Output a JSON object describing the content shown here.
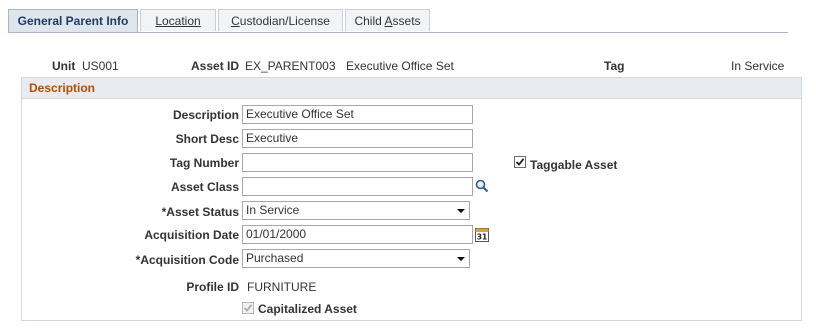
{
  "tabs": [
    {
      "label": "General Parent Info",
      "active": true
    },
    {
      "label": "Location"
    },
    {
      "pre": "",
      "ul": "C",
      "post": "ustodian/License"
    },
    {
      "pre": "Child ",
      "ul": "A",
      "post": "ssets"
    }
  ],
  "header": {
    "unit_label": "Unit",
    "unit_value": "US001",
    "asset_id_label": "Asset ID",
    "asset_id_value": "EX_PARENT003",
    "asset_desc": "Executive Office Set",
    "tag_label": "Tag",
    "status_value": "In Service"
  },
  "group": {
    "title": "Description"
  },
  "form": {
    "description_label": "Description",
    "description_value": "Executive Office Set",
    "short_desc_label": "Short Desc",
    "short_desc_value": "Executive",
    "tag_number_label": "Tag Number",
    "tag_number_value": "",
    "taggable_label": "Taggable Asset",
    "taggable_checked": true,
    "asset_class_label": "Asset Class",
    "asset_class_value": "",
    "asset_status_label": "*Asset Status",
    "asset_status_value": "In Service",
    "acq_date_label": "Acquisition Date",
    "acq_date_value": "01/01/2000",
    "acq_code_label": "*Acquisition Code",
    "acq_code_value": "Purchased",
    "profile_label": "Profile ID",
    "profile_value": "FURNITURE",
    "capitalized_label": "Capitalized Asset",
    "capitalized_checked": true
  },
  "icons": {
    "lookup": "magnifier-icon",
    "calendar": "calendar-icon",
    "calendar_day": "31"
  }
}
